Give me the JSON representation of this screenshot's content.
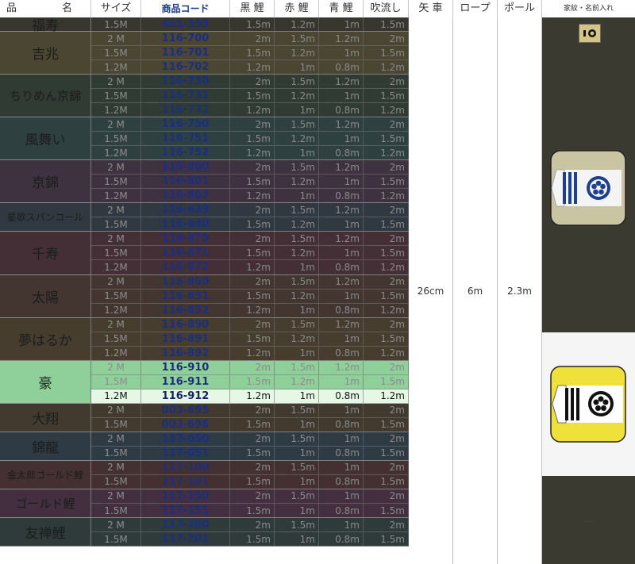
{
  "header": {
    "name_left": "品",
    "name_right": "名",
    "size": "サイズ",
    "code": "商品コード",
    "kuro": "黒 鯉",
    "aka": "赤 鯉",
    "ao": "青 鯉",
    "fuki": "吹流し",
    "yaguruma": "矢 車",
    "rope": "ロープ",
    "pole": "ポール",
    "kamon": "家紋・名前入れ"
  },
  "specs": {
    "yaguruma": "26cm",
    "rope": "6m",
    "pole": "2.3m"
  },
  "kamon_note": "—",
  "groups": [
    {
      "name": "福寿",
      "size": "big",
      "bg": "#37372f",
      "rows": [
        {
          "size": "1.5M",
          "code": "401-355",
          "v": [
            "1.5m",
            "1.2m",
            "1m",
            "1.5m"
          ]
        }
      ]
    },
    {
      "name": "吉兆",
      "size": "big",
      "bg": "#4a4631",
      "rows": [
        {
          "size": "2 M",
          "code": "116-700",
          "v": [
            "2m",
            "1.5m",
            "1.2m",
            "2m"
          ]
        },
        {
          "size": "1.5M",
          "code": "116-701",
          "v": [
            "1.5m",
            "1.2m",
            "1m",
            "1.5m"
          ]
        },
        {
          "size": "1.2M",
          "code": "116-702",
          "v": [
            "1.2m",
            "1m",
            "0.8m",
            "1.2m"
          ]
        }
      ]
    },
    {
      "name": "ちりめん京錦",
      "size": "mid",
      "bg": "#2f3b33",
      "rows": [
        {
          "size": "2 M",
          "code": "116-730",
          "v": [
            "2m",
            "1.5m",
            "1.2m",
            "2m"
          ]
        },
        {
          "size": "1.5M",
          "code": "116-731",
          "v": [
            "1.5m",
            "1.2m",
            "1m",
            "1.5m"
          ]
        },
        {
          "size": "1.2M",
          "code": "116-732",
          "v": [
            "1.2m",
            "1m",
            "0.8m",
            "1.2m"
          ]
        }
      ]
    },
    {
      "name": "風舞い",
      "size": "big",
      "bg": "#2e4040",
      "rows": [
        {
          "size": "2 M",
          "code": "116-750",
          "v": [
            "2m",
            "1.5m",
            "1.2m",
            "2m"
          ]
        },
        {
          "size": "1.5M",
          "code": "116-751",
          "v": [
            "1.5m",
            "1.2m",
            "1m",
            "1.5m"
          ]
        },
        {
          "size": "1.2M",
          "code": "116-752",
          "v": [
            "1.2m",
            "1m",
            "0.8m",
            "1.2m"
          ]
        }
      ]
    },
    {
      "name": "京錦",
      "size": "big",
      "bg": "#3e3240",
      "rows": [
        {
          "size": "2 M",
          "code": "116-800",
          "v": [
            "2m",
            "1.5m",
            "1.2m",
            "2m"
          ]
        },
        {
          "size": "1.5M",
          "code": "116-801",
          "v": [
            "1.5m",
            "1.2m",
            "1m",
            "1.5m"
          ]
        },
        {
          "size": "1.2M",
          "code": "116-802",
          "v": [
            "1.2m",
            "1m",
            "0.8m",
            "1.2m"
          ]
        }
      ]
    },
    {
      "name": "星歌スパンコール",
      "size": "sm",
      "bg": "#303841",
      "rows": [
        {
          "size": "2 M",
          "code": "116-639",
          "v": [
            "2m",
            "1.5m",
            "1.2m",
            "2m"
          ]
        },
        {
          "size": "1.5M",
          "code": "116-640",
          "v": [
            "1.5m",
            "1.2m",
            "1m",
            "1.5m"
          ]
        }
      ]
    },
    {
      "name": "千寿",
      "size": "big",
      "bg": "#442f36",
      "rows": [
        {
          "size": "2 M",
          "code": "116-870",
          "v": [
            "2m",
            "1.5m",
            "1.2m",
            "2m"
          ]
        },
        {
          "size": "1.5M",
          "code": "116-871",
          "v": [
            "1.5m",
            "1.2m",
            "1m",
            "1.5m"
          ]
        },
        {
          "size": "1.2M",
          "code": "116-872",
          "v": [
            "1.2m",
            "1m",
            "0.8m",
            "1.2m"
          ]
        }
      ]
    },
    {
      "name": "太陽",
      "size": "big",
      "bg": "#433530",
      "rows": [
        {
          "size": "2 M",
          "code": "116-850",
          "v": [
            "2m",
            "1.5m",
            "1.2m",
            "2m"
          ]
        },
        {
          "size": "1.5M",
          "code": "116-851",
          "v": [
            "1.5m",
            "1.2m",
            "1m",
            "1.5m"
          ]
        },
        {
          "size": "1.2M",
          "code": "116-852",
          "v": [
            "1.2m",
            "1m",
            "0.8m",
            "1.2m"
          ]
        }
      ]
    },
    {
      "name": "夢はるか",
      "size": "big",
      "bg": "#463d2e",
      "rows": [
        {
          "size": "2 M",
          "code": "116-890",
          "v": [
            "2m",
            "1.5m",
            "1.2m",
            "2m"
          ]
        },
        {
          "size": "1.5M",
          "code": "116-891",
          "v": [
            "1.5m",
            "1.2m",
            "1m",
            "1.5m"
          ]
        },
        {
          "size": "1.2M",
          "code": "116-892",
          "v": [
            "1.2m",
            "1m",
            "0.8m",
            "1.2m"
          ]
        }
      ]
    },
    {
      "name": "豪",
      "size": "big",
      "bg": "#8ecf9a",
      "highlight_last": true,
      "rows": [
        {
          "size": "2 M",
          "code": "116-910",
          "v": [
            "2m",
            "1.5m",
            "1.2m",
            "2m"
          ]
        },
        {
          "size": "1.5M",
          "code": "116-911",
          "v": [
            "1.5m",
            "1.2m",
            "1m",
            "1.5m"
          ]
        },
        {
          "size": "1.2M",
          "code": "116-912",
          "v": [
            "1.2m",
            "1m",
            "0.8m",
            "1.2m"
          ]
        }
      ]
    },
    {
      "name": "大翔",
      "size": "big",
      "bg": "#423a2e",
      "rows": [
        {
          "size": "2 M",
          "code": "003-695",
          "v": [
            "2m",
            "1.5m",
            "1m",
            "2m"
          ]
        },
        {
          "size": "1.5M",
          "code": "003-696",
          "v": [
            "1.5m",
            "1m",
            "0.8m",
            "1.5m"
          ]
        }
      ]
    },
    {
      "name": "錦龍",
      "size": "big",
      "bg": "#2f3b44",
      "rows": [
        {
          "size": "2 M",
          "code": "117-050",
          "v": [
            "2m",
            "1.5m",
            "1m",
            "2m"
          ]
        },
        {
          "size": "1.5M",
          "code": "117-051",
          "v": [
            "1.5m",
            "1m",
            "0.8m",
            "1.5m"
          ]
        }
      ]
    },
    {
      "name": "金太郎ゴールド鯉",
      "size": "sm",
      "bg": "#443030",
      "rows": [
        {
          "size": "2 M",
          "code": "117-100",
          "v": [
            "2m",
            "1.5m",
            "1m",
            "2m"
          ]
        },
        {
          "size": "1.5M",
          "code": "117-101",
          "v": [
            "1.5m",
            "1m",
            "0.8m",
            "1.5m"
          ]
        }
      ]
    },
    {
      "name": "ゴールド鯉",
      "size": "mid",
      "bg": "#432f40",
      "rows": [
        {
          "size": "2 M",
          "code": "117-150",
          "v": [
            "2m",
            "1.5m",
            "1m",
            "2m"
          ]
        },
        {
          "size": "1.5M",
          "code": "117-151",
          "v": [
            "1.5m",
            "1m",
            "0.8m",
            "1.5m"
          ]
        }
      ]
    },
    {
      "name": "友禅鯉",
      "size": "big",
      "bg": "#2f3b3b",
      "rows": [
        {
          "size": "2 M",
          "code": "117-200",
          "v": [
            "2m",
            "1.5m",
            "1m",
            "2m"
          ]
        },
        {
          "size": "1.5M",
          "code": "117-201",
          "v": [
            "1.5m",
            "1m",
            "0.8m",
            "1.5m"
          ]
        }
      ]
    }
  ]
}
